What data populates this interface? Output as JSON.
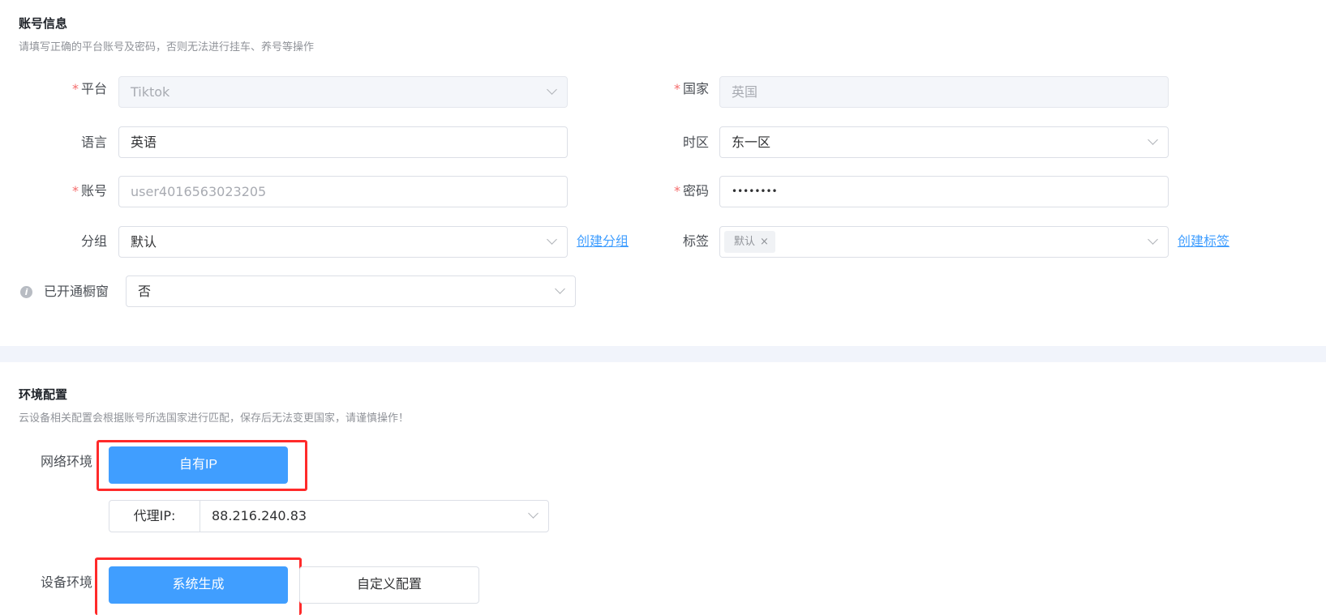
{
  "account": {
    "title": "账号信息",
    "description": "请填写正确的平台账号及密码，否则无法进行挂车、养号等操作",
    "platform": {
      "label": "平台",
      "value": "Tiktok",
      "required": true
    },
    "country": {
      "label": "国家",
      "value": "英国",
      "required": true
    },
    "language": {
      "label": "语言",
      "value": "英语"
    },
    "timezone": {
      "label": "时区",
      "value": "东一区"
    },
    "account": {
      "label": "账号",
      "placeholder": "user4016563023205",
      "required": true
    },
    "password": {
      "label": "密码",
      "value": "••••••••",
      "required": true
    },
    "group": {
      "label": "分组",
      "value": "默认",
      "create_link": "创建分组"
    },
    "tags": {
      "label": "标签",
      "tag_value": "默认",
      "tag_close": "×",
      "create_link": "创建标签"
    },
    "showcase": {
      "label": "已开通橱窗",
      "value": "否",
      "info_icon": "i"
    }
  },
  "env": {
    "title": "环境配置",
    "description": "云设备相关配置会根据账号所选国家进行匹配，保存后无法变更国家，请谨慎操作！",
    "network": {
      "label": "网络环境",
      "option_label": "自有IP"
    },
    "proxy": {
      "label": "代理IP:",
      "value": "88.216.240.83"
    },
    "device": {
      "label": "设备环境",
      "option_system": "系统生成",
      "option_custom": "自定义配置"
    }
  },
  "colors": {
    "primary": "#409eff",
    "required": "#f56c6c",
    "highlight": "#ff2a2a"
  }
}
